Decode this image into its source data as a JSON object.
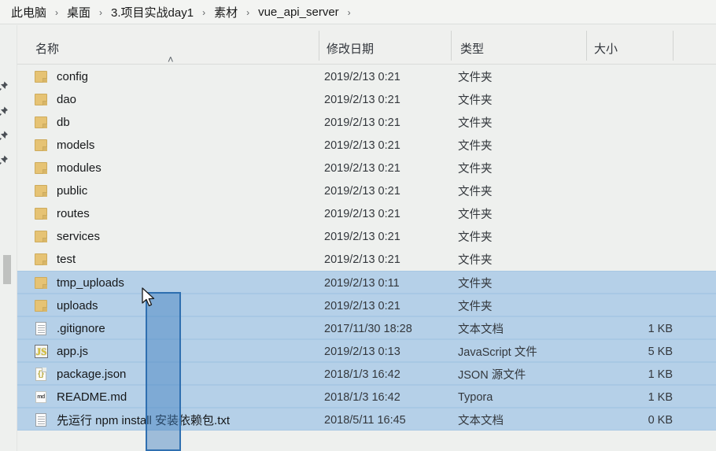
{
  "window": {
    "type": "file-explorer",
    "colors": {
      "background": "#eef0ee",
      "selection": "#b5d0e8",
      "marquee_fill": "#3c7dbe",
      "marquee_border": "#2f6fb0",
      "folder_icon": "#e6c374"
    }
  },
  "breadcrumb": {
    "separator": "›",
    "items": [
      {
        "label": "此电脑"
      },
      {
        "label": "桌面"
      },
      {
        "label": "3.项目实战day1"
      },
      {
        "label": "素材"
      },
      {
        "label": "vue_api_server"
      }
    ]
  },
  "columns": {
    "name": "名称",
    "date": "修改日期",
    "type": "类型",
    "size": "大小",
    "sort_indicator": "˄"
  },
  "gutter": {
    "pins": [
      "pin-icon",
      "pin-icon",
      "pin-icon",
      "pin-icon"
    ],
    "scrollbar": "vertical-scrollbar-thumb"
  },
  "files": [
    {
      "name": "config",
      "date": "2019/2/13 0:21",
      "type": "文件夹",
      "size": "",
      "icon": "folder",
      "selected": false
    },
    {
      "name": "dao",
      "date": "2019/2/13 0:21",
      "type": "文件夹",
      "size": "",
      "icon": "folder",
      "selected": false
    },
    {
      "name": "db",
      "date": "2019/2/13 0:21",
      "type": "文件夹",
      "size": "",
      "icon": "folder",
      "selected": false
    },
    {
      "name": "models",
      "date": "2019/2/13 0:21",
      "type": "文件夹",
      "size": "",
      "icon": "folder",
      "selected": false
    },
    {
      "name": "modules",
      "date": "2019/2/13 0:21",
      "type": "文件夹",
      "size": "",
      "icon": "folder",
      "selected": false
    },
    {
      "name": "public",
      "date": "2019/2/13 0:21",
      "type": "文件夹",
      "size": "",
      "icon": "folder",
      "selected": false
    },
    {
      "name": "routes",
      "date": "2019/2/13 0:21",
      "type": "文件夹",
      "size": "",
      "icon": "folder",
      "selected": false
    },
    {
      "name": "services",
      "date": "2019/2/13 0:21",
      "type": "文件夹",
      "size": "",
      "icon": "folder",
      "selected": false
    },
    {
      "name": "test",
      "date": "2019/2/13 0:21",
      "type": "文件夹",
      "size": "",
      "icon": "folder",
      "selected": false
    },
    {
      "name": "tmp_uploads",
      "date": "2019/2/13 0:11",
      "type": "文件夹",
      "size": "",
      "icon": "folder",
      "selected": true
    },
    {
      "name": "uploads",
      "date": "2019/2/13 0:21",
      "type": "文件夹",
      "size": "",
      "icon": "folder",
      "selected": true
    },
    {
      "name": ".gitignore",
      "date": "2017/11/30 18:28",
      "type": "文本文档",
      "size": "1 KB",
      "icon": "doc",
      "selected": true
    },
    {
      "name": "app.js",
      "date": "2019/2/13 0:13",
      "type": "JavaScript 文件",
      "size": "5 KB",
      "icon": "js",
      "selected": true
    },
    {
      "name": "package.json",
      "date": "2018/1/3 16:42",
      "type": "JSON 源文件",
      "size": "1 KB",
      "icon": "json",
      "selected": true
    },
    {
      "name": "README.md",
      "date": "2018/1/3 16:42",
      "type": "Typora",
      "size": "1 KB",
      "icon": "md",
      "selected": true
    },
    {
      "name": "先运行 npm install 安装依赖包.txt",
      "date": "2018/5/11 16:45",
      "type": "文本文档",
      "size": "0 KB",
      "icon": "doc",
      "selected": true
    }
  ],
  "overlay": {
    "marquee": "drag-selection-rectangle",
    "cursor": "mouse-pointer"
  }
}
